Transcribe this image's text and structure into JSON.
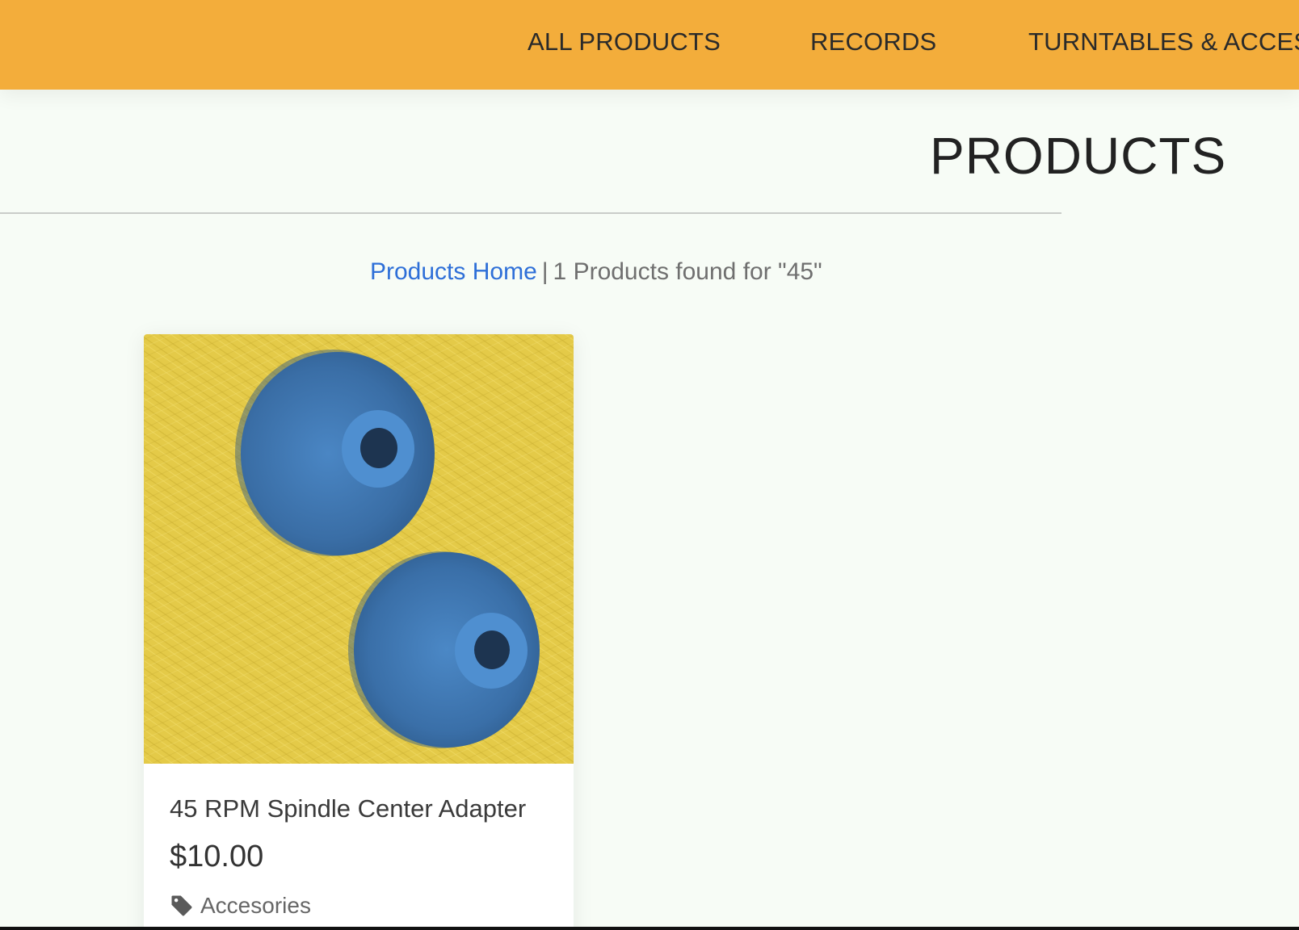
{
  "nav": {
    "items": [
      {
        "label": "ALL PRODUCTS"
      },
      {
        "label": "RECORDS"
      },
      {
        "label": "TURNTABLES & ACCESO"
      }
    ]
  },
  "main": {
    "title": "PRODUCTS",
    "breadcrumb": {
      "home_link": "Products Home",
      "separator": "|",
      "results_text": "1 Products found for \"45\""
    },
    "products": [
      {
        "name": "45 RPM Spindle Center Adapter",
        "price": "$10.00",
        "category": "Accesories",
        "image_icon": "blue-spindle-adapters-photo",
        "category_icon": "tag-icon"
      }
    ]
  },
  "colors": {
    "nav_bg": "#f3ad3b",
    "page_bg": "#f7fcf6",
    "link": "#2e6fd8",
    "image_bg": "#e6cc4a",
    "adapter_blue": "#3c6fa6"
  }
}
